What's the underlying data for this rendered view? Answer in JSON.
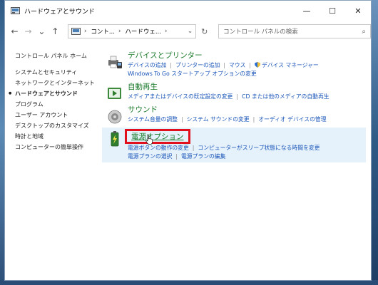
{
  "window": {
    "title": "ハードウェアとサウンド",
    "minimize_icon": "minimize-icon",
    "maximize_icon": "maximize-icon",
    "close_icon": "close-icon"
  },
  "address_bar": {
    "segments": [
      "コント...",
      "ハードウェ..."
    ],
    "search_placeholder": "コントロール パネルの検索"
  },
  "sidebar": {
    "home": "コントロール パネル ホーム",
    "items": [
      "システムとセキュリティ",
      "ネットワークとインターネット",
      "ハードウェアとサウンド",
      "プログラム",
      "ユーザー アカウント",
      "デスクトップのカスタマイズ",
      "時計と地域",
      "コンピューターの簡単操作"
    ],
    "active_index": 2
  },
  "categories": {
    "devices": {
      "title": "デバイスとプリンター",
      "links_row1": [
        "デバイスの追加",
        "プリンターの追加",
        "マウス",
        "デバイス マネージャー"
      ],
      "links_row2": [
        "Windows To Go スタートアップ オプションの変更"
      ]
    },
    "autoplay": {
      "title": "自動再生",
      "links": [
        "メディアまたはデバイスの既定設定の変更",
        "CD または他のメディアの自動再生"
      ]
    },
    "sound": {
      "title": "サウンド",
      "links": [
        "システム音量の調整",
        "システム サウンドの変更",
        "オーディオ デバイスの管理"
      ]
    },
    "power": {
      "title": "電源オプション",
      "links_row1": [
        "電源ボタンの動作の変更",
        "コンピューターがスリープ状態になる時間を変更"
      ],
      "links_row2": [
        "電源プランの選択",
        "電源プランの編集"
      ]
    }
  },
  "colors": {
    "category_title": "#1a7a2a",
    "link": "#1a55b8",
    "highlight_box": "#e0101c",
    "selected_row_bg": "#e6f2fb"
  }
}
